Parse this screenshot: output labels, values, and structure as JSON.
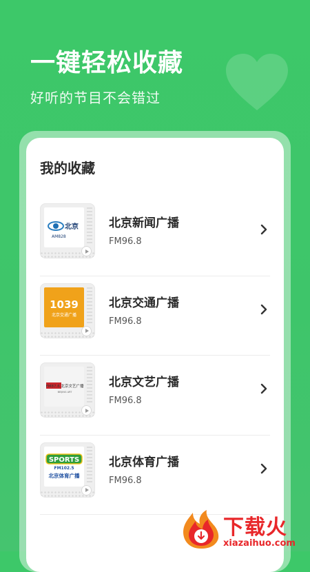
{
  "hero": {
    "title": "一键轻松收藏",
    "subtitle": "好听的节目不会错过"
  },
  "card": {
    "title": "我的收藏",
    "items": [
      {
        "name": "北京新闻广播",
        "freq": "FM96.8",
        "logo_text": "北京",
        "logo_sub": "AM828"
      },
      {
        "name": "北京交通广播",
        "freq": "FM96.8",
        "logo_text": "1039",
        "logo_sub": "北京交通广播"
      },
      {
        "name": "北京文艺广播",
        "freq": "FM96.8",
        "logo_text": "FM87.6 北京文艺广播",
        "logo_sub": "BEIJING ART"
      },
      {
        "name": "北京体育广播",
        "freq": "FM96.8",
        "logo_text": "SPORTS",
        "logo_sub": "FM102.5",
        "logo_sub2": "北京体育广播"
      }
    ]
  },
  "watermark": {
    "text": "下载火",
    "url": "xiazaihuo.com"
  },
  "colors": {
    "background": "#3ec56a",
    "accent_orange": "#f0a21a",
    "watermark_red": "#e8272a"
  }
}
